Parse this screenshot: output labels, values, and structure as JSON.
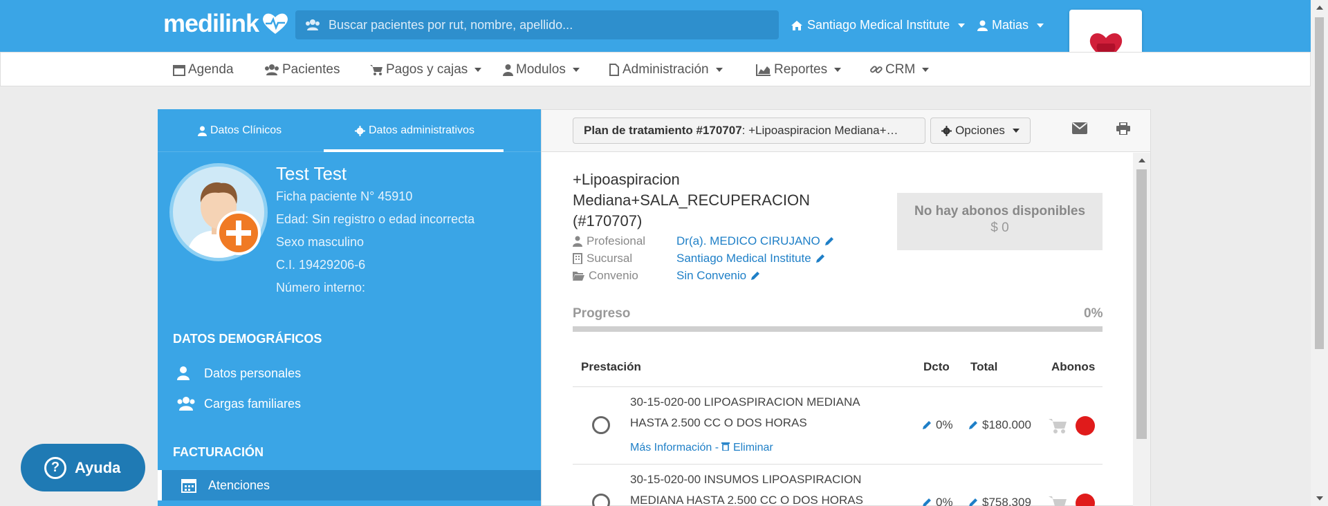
{
  "app": {
    "brand": "medilink",
    "search_placeholder": "Buscar pacientes por rut, nombre, apellido...",
    "institution": "Santiago Medical Institute",
    "user": "Matias"
  },
  "menu": [
    {
      "label": "Agenda",
      "icon": "calendar-icon"
    },
    {
      "label": "Pacientes",
      "icon": "users-icon"
    },
    {
      "label": "Pagos y cajas",
      "icon": "cart-icon"
    },
    {
      "label": "Modulos",
      "icon": "user-md-icon"
    },
    {
      "label": "Administración",
      "icon": "file-icon"
    },
    {
      "label": "Reportes",
      "icon": "chart-icon"
    },
    {
      "label": "CRM",
      "icon": "link-icon"
    }
  ],
  "left": {
    "tab_clinical": "Datos Clínicos",
    "tab_admin": "Datos administrativos",
    "patient": {
      "name": "Test Test",
      "ficha": "Ficha paciente N° 45910",
      "edad": "Edad: Sin registro o edad incorrecta",
      "sexo": "Sexo masculino",
      "ci": "C.I. 19429206-6",
      "interno": "Número interno:"
    },
    "demo_title": "DATOS DEMOGRÁFICOS",
    "demo_items": [
      "Datos personales",
      "Cargas familiares"
    ],
    "fact_title": "FACTURACIÓN",
    "fact_items": [
      "Atenciones"
    ]
  },
  "right": {
    "plan_btn_bold": "Plan de tratamiento #170707",
    "plan_btn_rest": ": +Lipoaspiracion Mediana+…",
    "options_label": "Opciones",
    "plan_title": "+Lipoaspiracion Mediana+SALA_RECUPERACION (#170707)",
    "profesional_label": "Profesional",
    "profesional_value": "Dr(a). MEDICO CIRUJANO",
    "sucursal_label": "Sucursal",
    "sucursal_value": "Santiago Medical Institute",
    "convenio_label": "Convenio",
    "convenio_value": "Sin Convenio",
    "abonos_title": "No hay abonos disponibles",
    "abonos_amount": "$ 0",
    "progress_label": "Progreso",
    "progress_value": "0%",
    "progress_fraction": 0,
    "columns": {
      "prestacion": "Prestación",
      "dcto": "Dcto",
      "total": "Total",
      "abonos": "Abonos"
    },
    "rows": [
      {
        "text": "30-15-020-00 LIPOASPIRACION MEDIANA HASTA 2.500 CC O DOS HORAS",
        "links": "Más Información - ",
        "delete": "Eliminar",
        "dcto": "0%",
        "total": "$180.000"
      },
      {
        "text": "30-15-020-00 INSUMOS LIPOASPIRACION MEDIANA HASTA 2.500 CC O DOS HORAS",
        "dcto": "0%",
        "total": "$758.309"
      }
    ]
  },
  "help_label": "Ayuda",
  "colors": {
    "primary": "#3aa5e6",
    "dark": "#2b8ccb",
    "link": "#1e7fc7",
    "danger": "#e01b1b"
  }
}
